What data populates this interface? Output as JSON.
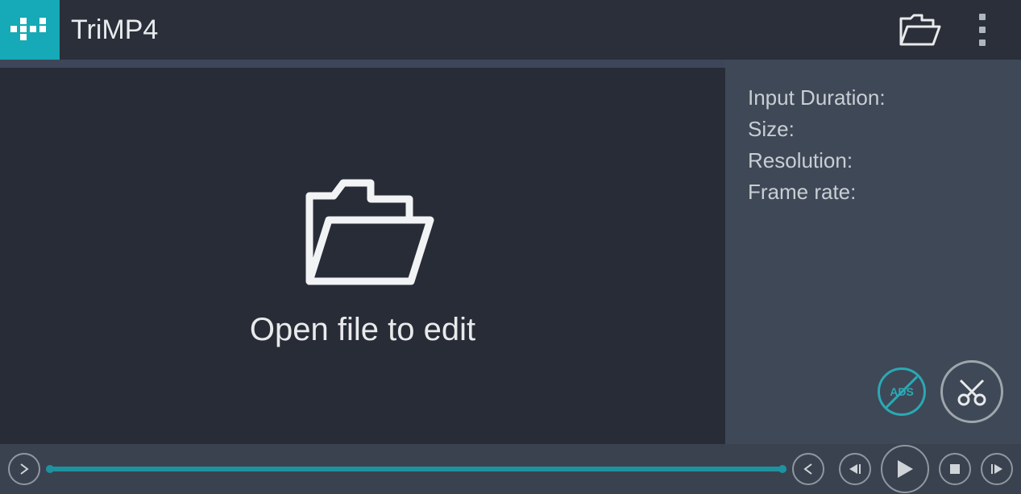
{
  "app": {
    "title": "TriMP4"
  },
  "preview": {
    "open_prompt": "Open file to edit"
  },
  "info": {
    "duration_label": "Input Duration:",
    "size_label": "Size:",
    "resolution_label": "Resolution:",
    "framerate_label": "Frame rate:"
  },
  "ads": {
    "label": "ADS"
  }
}
